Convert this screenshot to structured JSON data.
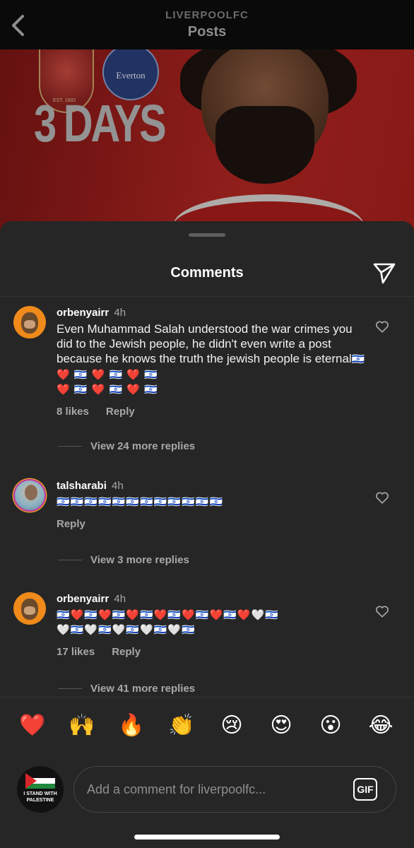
{
  "header": {
    "account": "LIVERPOOLFC",
    "title": "Posts"
  },
  "post_image": {
    "countdown_text": "3 DAYS",
    "crest_left_text": "EST. 1892",
    "crest_right_text": "Everton"
  },
  "sheet": {
    "title": "Comments"
  },
  "comments": [
    {
      "username": "orbenyairr",
      "time": "4h",
      "text": "Even Muhammad Salah understood the war crimes you did to the Jewish people, he didn't even write a post because he knows the truth the jewish people is eternal",
      "emojis": "🇮🇱 ❤️ 🇮🇱 ❤️ 🇮🇱 ❤️ 🇮🇱",
      "emojis_line2": "❤️ 🇮🇱 ❤️ 🇮🇱 ❤️ 🇮🇱",
      "likes": "8 likes",
      "reply": "Reply",
      "more_replies": "View 24 more replies"
    },
    {
      "username": "talsharabi",
      "time": "4h",
      "emojis": "🇮🇱🇮🇱🇮🇱🇮🇱🇮🇱🇮🇱🇮🇱🇮🇱🇮🇱🇮🇱🇮🇱🇮🇱",
      "reply": "Reply",
      "more_replies": "View 3 more replies"
    },
    {
      "username": "orbenyairr",
      "time": "4h",
      "emojis": "🇮🇱❤️🇮🇱❤️🇮🇱❤️🇮🇱❤️🇮🇱❤️🇮🇱❤️🇮🇱❤️🤍🇮🇱",
      "emojis_line2": "🤍🇮🇱🤍🇮🇱🤍🇮🇱🤍🇮🇱🤍🇮🇱",
      "likes": "17 likes",
      "reply": "Reply",
      "more_replies": "View 41 more replies"
    }
  ],
  "reactions": [
    "❤️",
    "🙌",
    "🔥",
    "👏",
    "😢",
    "😍",
    "😮",
    "😂"
  ],
  "composer": {
    "avatar_text": "I STAND WITH PALESTINE",
    "placeholder": "Add a comment for liverpoolfc...",
    "gif_label": "GIF"
  },
  "colors": {
    "sheet_bg": "#262626",
    "secondary_text": "#a8a8a8",
    "post_red": "#a51f1c"
  },
  "icons": {
    "back": "chevron-left-icon",
    "share": "paper-plane-icon",
    "like": "heart-outline-icon"
  }
}
